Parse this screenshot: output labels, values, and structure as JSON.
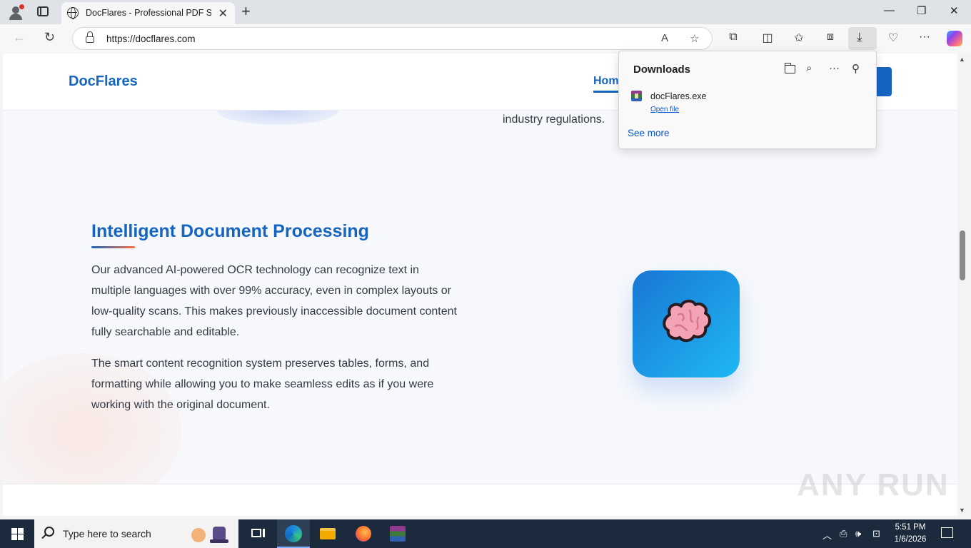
{
  "browser": {
    "tab_title": "DocFlares - Professional PDF Software",
    "url": "https://docflares.com"
  },
  "page": {
    "logo": "DocFlares",
    "nav_home": "Home",
    "partial_text": "industry regulations.",
    "feature": {
      "title": "Intelligent Document Processing",
      "paragraph1": "Our advanced AI-powered OCR technology can recognize text in multiple languages with over 99% accuracy, even in complex layouts or low-quality scans. This makes previously inaccessible document content fully searchable and editable.",
      "paragraph2": "The smart content recognition system preserves tables, forms, and formatting while allowing you to make seamless edits as if you were working with the original document.",
      "icon": "brain-icon"
    }
  },
  "downloads": {
    "title": "Downloads",
    "file_name": "docFlares.exe",
    "open_file": "Open file",
    "see_more": "See more"
  },
  "taskbar": {
    "search_placeholder": "Type here to search",
    "time": "5:51 PM",
    "date": "1/6/2026"
  },
  "watermark": "ANY RUN",
  "colors": {
    "brand": "#1565c0",
    "card_gradient_start": "#1976d2",
    "card_gradient_end": "#1fb8f5"
  }
}
